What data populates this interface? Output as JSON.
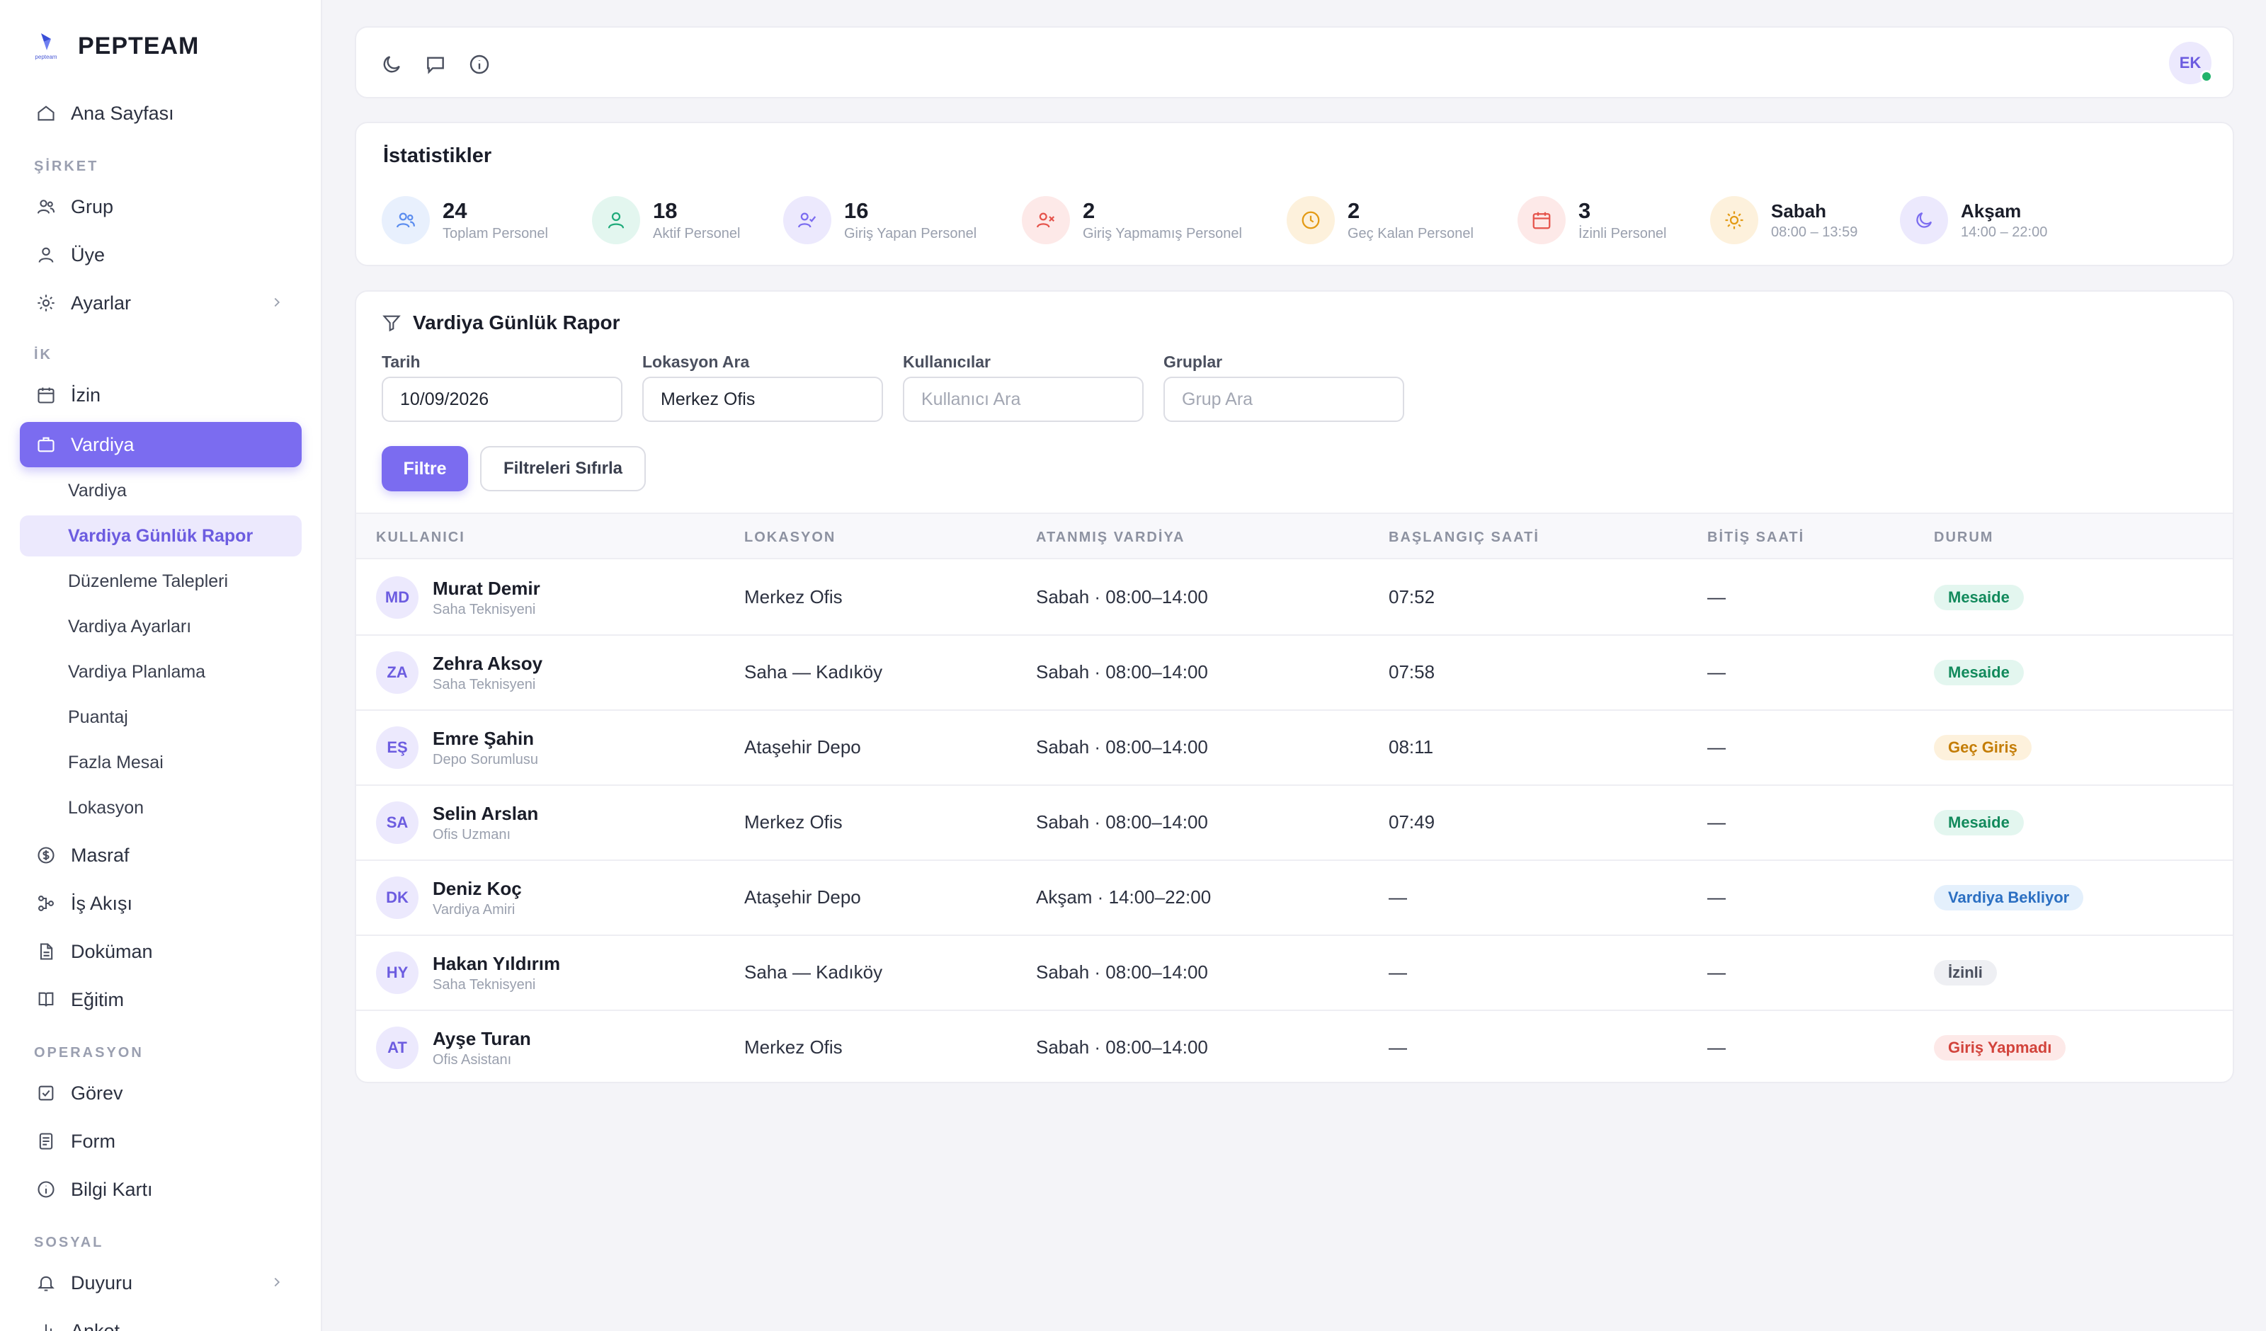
{
  "brand": {
    "name": "PEPTEAM",
    "logo_text": "pepteam"
  },
  "sidebar": {
    "home": "Ana Sayfası",
    "sections": {
      "sirket": "ŞİRKET",
      "ik": "İK",
      "operasyon": "OPERASYON",
      "sosyal": "SOSYAL"
    },
    "sirket_items": [
      "Grup",
      "Üye",
      "Ayarlar"
    ],
    "ik_items": [
      "İzin",
      "Vardiya"
    ],
    "vardiya_sub": [
      "Vardiya",
      "Vardiya Günlük Rapor",
      "Düzenleme Talepleri",
      "Vardiya Ayarları",
      "Vardiya Planlama",
      "Puantaj",
      "Fazla Mesai",
      "Lokasyon"
    ],
    "ik_more": [
      "Masraf",
      "İş Akışı",
      "Doküman",
      "Eğitim"
    ],
    "operasyon_items": [
      "Görev",
      "Form",
      "Bilgi Kartı"
    ],
    "sosyal_items": [
      "Duyuru",
      "Anket"
    ]
  },
  "topbar": {
    "user_initials": "EK",
    "icons": [
      "moon-icon",
      "chat-icon",
      "info-icon"
    ]
  },
  "stats": {
    "title": "İstatistikler",
    "items": [
      {
        "value": "24",
        "label": "Toplam Personel",
        "icon": "users-icon",
        "color": "#5b8def",
        "bg": "#e8f0fd"
      },
      {
        "value": "18",
        "label": "Aktif Personel",
        "icon": "user-icon",
        "color": "#1faa7a",
        "bg": "#e3f6ef"
      },
      {
        "value": "16",
        "label": "Giriş Yapan Personel",
        "icon": "user-check-icon",
        "color": "#7b6cf0",
        "bg": "#ece9fd"
      },
      {
        "value": "2",
        "label": "Giriş Yapmamış Personel",
        "icon": "user-x-icon",
        "color": "#e5534b",
        "bg": "#fde9e8"
      },
      {
        "value": "2",
        "label": "Geç Kalan Personel",
        "icon": "clock-icon",
        "color": "#e39a14",
        "bg": "#fdf1dc"
      },
      {
        "value": "3",
        "label": "İzinli Personel",
        "icon": "calendar-icon",
        "color": "#e5534b",
        "bg": "#fde9e8"
      },
      {
        "value": "Sabah",
        "label": "08:00 – 13:59",
        "icon": "sun-icon",
        "color": "#e39a14",
        "bg": "#fdf1dc"
      },
      {
        "value": "Akşam",
        "label": "14:00 – 22:00",
        "icon": "moon-icon",
        "color": "#7b6cf0",
        "bg": "#ece9fd"
      }
    ]
  },
  "report": {
    "title": "Vardiya Günlük Rapor",
    "filters": {
      "date_label": "Tarih",
      "date_value": "10/09/2026",
      "location_label": "Lokasyon Ara",
      "location_value": "Merkez Ofis",
      "users_label": "Kullanıcılar",
      "users_placeholder": "Kullanıcı Ara",
      "groups_label": "Gruplar",
      "groups_placeholder": "Grup Ara",
      "filter_button": "Filtre",
      "reset_button": "Filtreleri Sıfırla"
    },
    "columns": [
      "KULLANICI",
      "LOKASYON",
      "ATANMIŞ VARDİYA",
      "BAŞLANGIÇ SAATİ",
      "BİTİŞ SAATİ",
      "DURUM"
    ],
    "rows": [
      {
        "initials": "MD",
        "name": "Murat Demir",
        "role": "Saha Teknisyeni",
        "location": "Merkez Ofis",
        "shift": "Sabah · 08:00–14:00",
        "start": "07:52",
        "end": "—",
        "status": "Mesaide",
        "status_type": "green"
      },
      {
        "initials": "ZA",
        "name": "Zehra Aksoy",
        "role": "Saha Teknisyeni",
        "location": "Saha — Kadıköy",
        "shift": "Sabah · 08:00–14:00",
        "start": "07:58",
        "end": "—",
        "status": "Mesaide",
        "status_type": "green"
      },
      {
        "initials": "EŞ",
        "name": "Emre Şahin",
        "role": "Depo Sorumlusu",
        "location": "Ataşehir Depo",
        "shift": "Sabah · 08:00–14:00",
        "start": "08:11",
        "end": "—",
        "status": "Geç Giriş",
        "status_type": "orange"
      },
      {
        "initials": "SA",
        "name": "Selin Arslan",
        "role": "Ofis Uzmanı",
        "location": "Merkez Ofis",
        "shift": "Sabah · 08:00–14:00",
        "start": "07:49",
        "end": "—",
        "status": "Mesaide",
        "status_type": "green"
      },
      {
        "initials": "DK",
        "name": "Deniz Koç",
        "role": "Vardiya Amiri",
        "location": "Ataşehir Depo",
        "shift": "Akşam · 14:00–22:00",
        "start": "—",
        "end": "—",
        "status": "Vardiya Bekliyor",
        "status_type": "blue"
      },
      {
        "initials": "HY",
        "name": "Hakan Yıldırım",
        "role": "Saha Teknisyeni",
        "location": "Saha — Kadıköy",
        "shift": "Sabah · 08:00–14:00",
        "start": "—",
        "end": "—",
        "status": "İzinli",
        "status_type": "gray"
      },
      {
        "initials": "AT",
        "name": "Ayşe Turan",
        "role": "Ofis Asistanı",
        "location": "Merkez Ofis",
        "shift": "Sabah · 08:00–14:00",
        "start": "—",
        "end": "—",
        "status": "Giriş Yapmadı",
        "status_type": "red"
      }
    ]
  },
  "colors": {
    "accent": "#7b6cf0",
    "accent_light": "#ece9fd",
    "online": "#22b36b"
  }
}
